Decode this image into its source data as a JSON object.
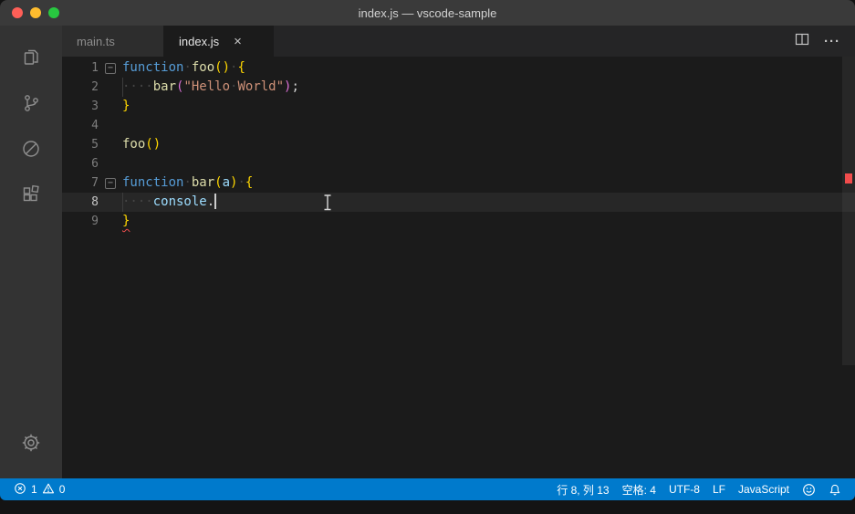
{
  "window": {
    "title": "index.js — vscode-sample"
  },
  "activity_bar": {
    "icons": [
      "explorer-icon",
      "source-control-icon",
      "debug-disabled-icon",
      "extensions-icon"
    ],
    "bottom_icons": [
      "settings-gear-icon"
    ]
  },
  "tabs": [
    {
      "label": "main.ts",
      "active": false
    },
    {
      "label": "index.js",
      "active": true,
      "close_label": "×"
    }
  ],
  "editor_actions": {
    "more_label": "···"
  },
  "editor": {
    "fold_glyph": "−",
    "lines": [
      {
        "num": "1",
        "fold": true,
        "tokens": [
          [
            "kw",
            "function"
          ],
          [
            "ws",
            "·"
          ],
          [
            "fn",
            "foo"
          ],
          [
            "b1",
            "()"
          ],
          [
            "ws",
            "·"
          ],
          [
            "b1",
            "{"
          ]
        ]
      },
      {
        "num": "2",
        "indent_guide": true,
        "tokens": [
          [
            "ws",
            "····"
          ],
          [
            "fn",
            "bar"
          ],
          [
            "b2",
            "("
          ],
          [
            "str",
            "\"Hello"
          ],
          [
            "ws",
            "·"
          ],
          [
            "str",
            "World\""
          ],
          [
            "b2",
            ")"
          ],
          [
            "pun",
            ";"
          ]
        ]
      },
      {
        "num": "3",
        "tokens": [
          [
            "b1",
            "}"
          ]
        ]
      },
      {
        "num": "4",
        "tokens": []
      },
      {
        "num": "5",
        "tokens": [
          [
            "fn",
            "foo"
          ],
          [
            "b1",
            "()"
          ]
        ]
      },
      {
        "num": "6",
        "tokens": []
      },
      {
        "num": "7",
        "fold": true,
        "tokens": [
          [
            "kw",
            "function"
          ],
          [
            "ws",
            "·"
          ],
          [
            "fn",
            "bar"
          ],
          [
            "b1",
            "("
          ],
          [
            "var",
            "a"
          ],
          [
            "b1",
            ")"
          ],
          [
            "ws",
            "·"
          ],
          [
            "b1",
            "{"
          ]
        ]
      },
      {
        "num": "8",
        "current": true,
        "caret": true,
        "indent_guide": true,
        "tokens": [
          [
            "ws",
            "····"
          ],
          [
            "var",
            "console"
          ],
          [
            "pun",
            "."
          ]
        ]
      },
      {
        "num": "9",
        "tokens": [
          [
            "err",
            "}"
          ]
        ]
      }
    ]
  },
  "status_bar": {
    "errors": "1",
    "warnings": "0",
    "cursor_position": "行 8, 列 13",
    "indentation": "空格: 4",
    "encoding": "UTF-8",
    "eol": "LF",
    "language": "JavaScript"
  },
  "colors": {
    "status_bar_bg": "#007acc",
    "editor_bg": "#1b1b1b",
    "titlebar_bg": "#3a3a3a",
    "activitybar_bg": "#333333",
    "keyword": "#569cd6",
    "function": "#dcdcaa",
    "variable": "#9cdcfe",
    "string": "#ce9178",
    "bracket_gold": "#ffd700",
    "bracket_pink": "#da70d6",
    "error_red": "#f14c4c"
  }
}
